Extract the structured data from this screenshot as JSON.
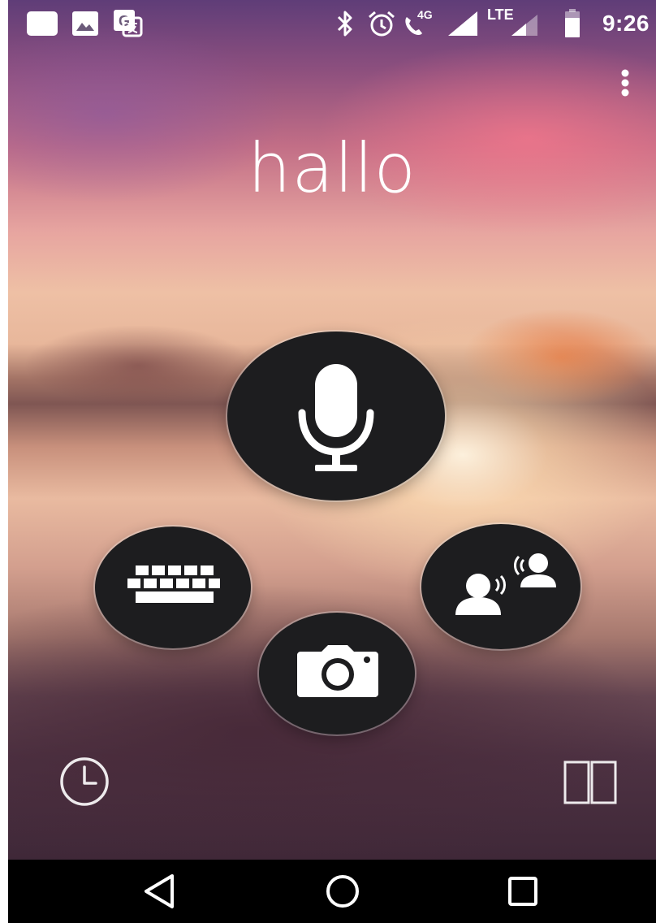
{
  "status_bar": {
    "time": "9:26",
    "left_icons": [
      "notification-square-icon",
      "image-icon",
      "translate-icon"
    ],
    "right_icons": [
      "bluetooth-icon",
      "alarm-icon",
      "volte-call-icon",
      "signal-icon",
      "lte-signal-icon",
      "battery-icon"
    ],
    "network_label": "LTE",
    "call_label": "4G"
  },
  "main": {
    "translation_text": "hallo"
  },
  "actions": {
    "voice": "microphone-icon",
    "keyboard": "keyboard-icon",
    "conversation": "conversation-icon",
    "camera": "camera-icon"
  },
  "bottom": {
    "history": "history-clock-icon",
    "phrasebook": "phrasebook-icon"
  },
  "nav": {
    "back": "back-icon",
    "home": "home-icon",
    "recents": "recents-icon"
  },
  "colors": {
    "button_fill": "#1d1d1f",
    "icon": "#ffffff",
    "navbar": "#000000"
  }
}
